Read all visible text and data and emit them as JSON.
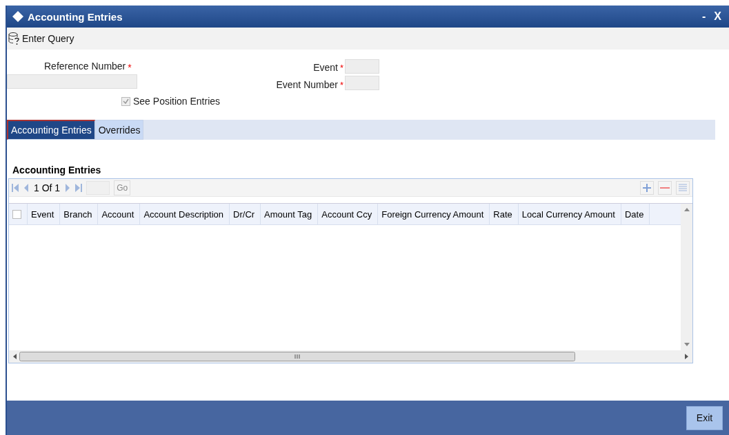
{
  "window": {
    "title": "Accounting Entries",
    "controls": [
      "-",
      "X"
    ]
  },
  "toolbar": {
    "items": [
      {
        "label": "Enter Query"
      }
    ]
  },
  "form": {
    "fields": [
      {
        "label": "Reference Number",
        "required_mark": "*",
        "kind": "wide"
      },
      {
        "label": "Event",
        "required_mark": "*",
        "kind": "short"
      },
      {
        "label": "Event Number",
        "required_mark": "*",
        "kind": "short"
      }
    ],
    "checkbox": {
      "label": "See Position Entries",
      "checked": true,
      "disabled": true
    }
  },
  "tabs": [
    {
      "label": "Accounting Entries",
      "selected": true
    },
    {
      "label": "Overrides",
      "selected": false
    }
  ],
  "grid": {
    "title": "Accounting Entries",
    "pager": "1 Of 1",
    "go": "Go",
    "columns": [
      "Event",
      "Branch",
      "Account",
      "Account Description",
      "Dr/Cr",
      "Amount Tag",
      "Account Ccy",
      "Foreign Currency Amount",
      "Rate",
      "Local Currency Amount",
      "Date"
    ],
    "select_all": false
  },
  "footer": {
    "buttons": [
      "Exit"
    ]
  }
}
